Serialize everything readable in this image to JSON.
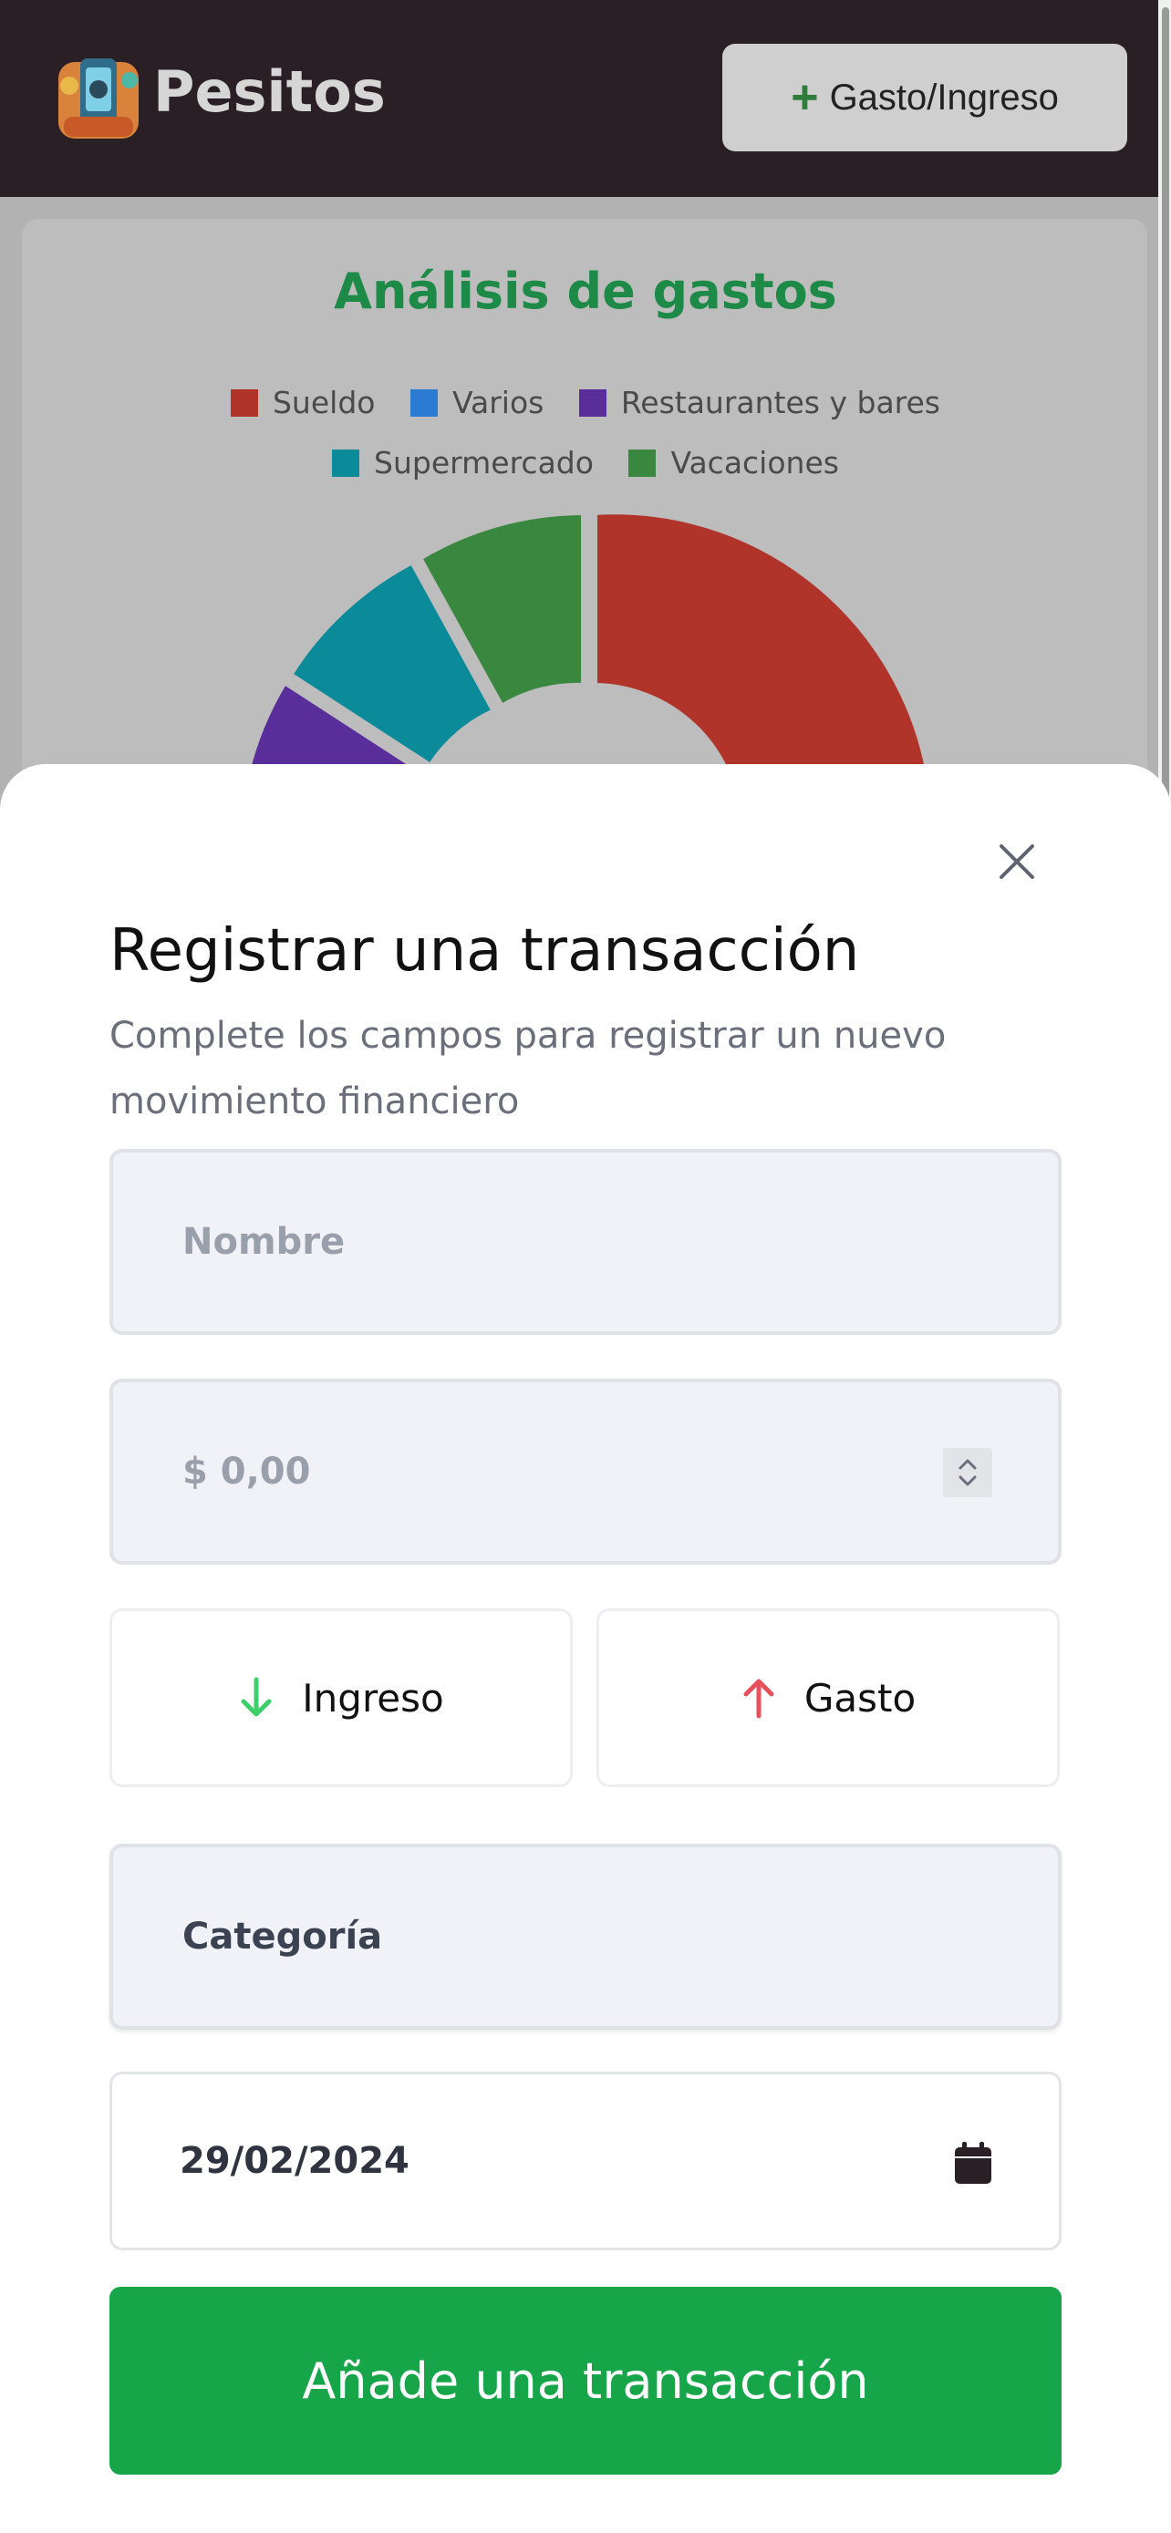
{
  "header": {
    "brand": "Pesitos",
    "add_button_plus": "+",
    "add_button_label": "Gasto/Ingreso"
  },
  "chart_card": {
    "title": "Análisis de gastos"
  },
  "chart_data": {
    "type": "pie",
    "title": "Análisis de gastos",
    "donut": true,
    "legend_position": "top",
    "categories": [
      "Sueldo",
      "Varios",
      "Restaurantes y bares",
      "Supermercado",
      "Vacaciones"
    ],
    "colors": [
      "#b0342a",
      "#2a7bd1",
      "#5a2e9a",
      "#0b8a9a",
      "#3a873f"
    ],
    "values": [
      null,
      null,
      null,
      null,
      null
    ]
  },
  "modal": {
    "title": "Registrar una transacción",
    "subtitle": "Complete los campos para registrar un nuevo movimiento financiero",
    "name_placeholder": "Nombre",
    "amount_placeholder": "$ 0,00",
    "income_label": "Ingreso",
    "expense_label": "Gasto",
    "category_label": "Categoría",
    "date_value": "29/02/2024",
    "submit_label": "Añade una transacción"
  },
  "colors": {
    "header_bg": "#2b1f26",
    "accent_green": "#17a54a",
    "income_arrow": "#3ccf6a",
    "expense_arrow": "#e8505b"
  },
  "icons": {
    "close": "close-icon",
    "income": "arrow-down-icon",
    "expense": "arrow-up-icon",
    "calendar": "calendar-icon",
    "spinner": "chevron-updown-icon"
  }
}
